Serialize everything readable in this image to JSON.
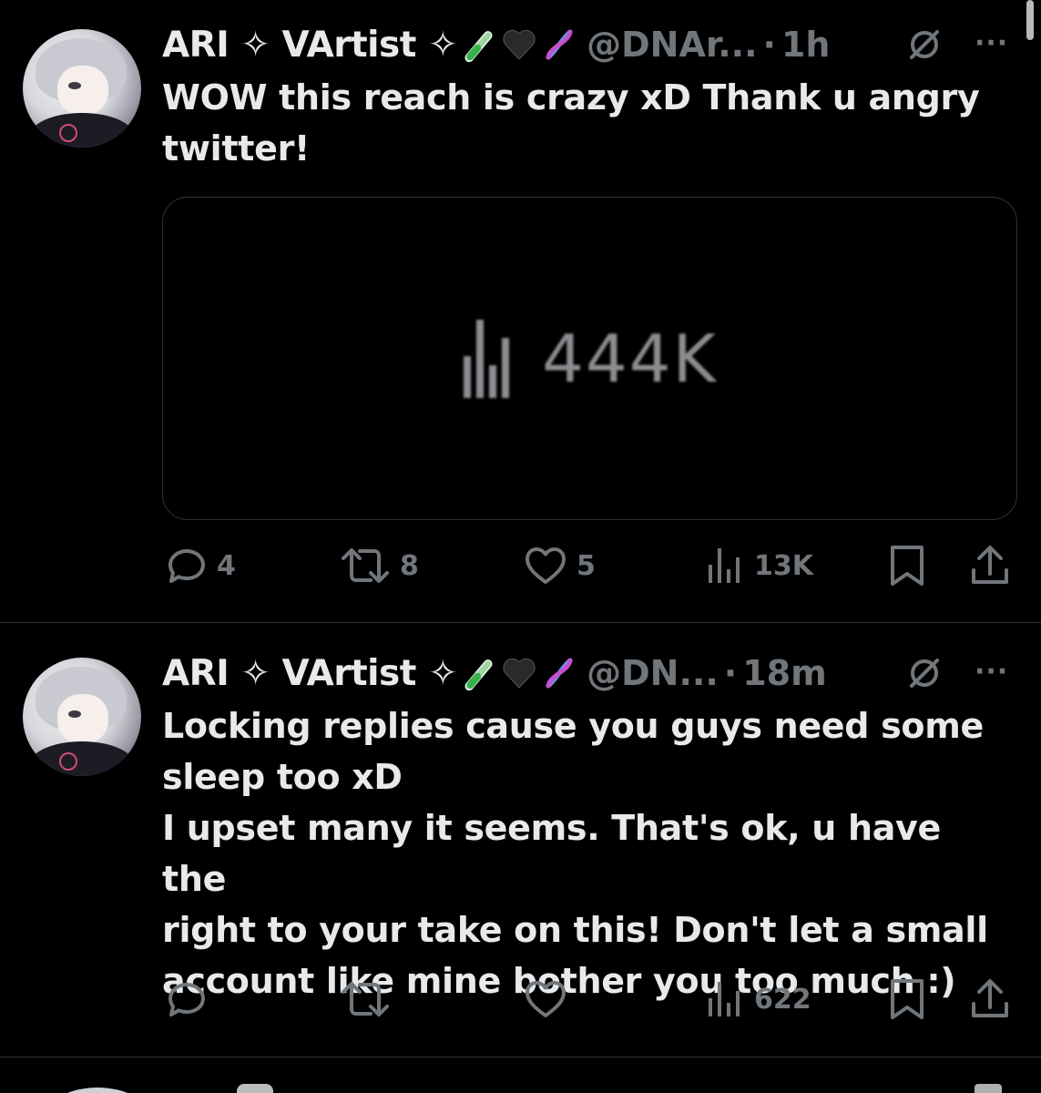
{
  "tweets": [
    {
      "display_name": "ARI ✧ VArtist ✧",
      "handle": "@DNAr...",
      "separator": "·",
      "time": "1h",
      "more": "···",
      "text_lines": [
        "WOW this reach is crazy xD Thank u angry",
        "twitter!"
      ],
      "media": {
        "views_label": "444K"
      },
      "actions": {
        "replies": "4",
        "reposts": "8",
        "likes": "5",
        "views": "13K"
      }
    },
    {
      "display_name": "ARI ✧ VArtist ✧",
      "handle": "@DN...",
      "separator": "·",
      "time": "18m",
      "more": "···",
      "text_lines": [
        "Locking replies cause you guys need some",
        "sleep too xD",
        "I upset many it seems. That's ok, u have the",
        "right to your take on this! Don't let a small",
        "account like mine bother you too much :)"
      ],
      "actions": {
        "replies": "",
        "reposts": "",
        "likes": "",
        "views": "622"
      }
    }
  ],
  "colors": {
    "background": "#000000",
    "text": "#e7e9ea",
    "muted": "#71767b",
    "border": "#2f3336"
  },
  "icons": [
    "test-tube-emoji",
    "black-heart-emoji",
    "dna-emoji",
    "grok-icon",
    "reply-icon",
    "repost-icon",
    "like-icon",
    "views-icon",
    "bookmark-icon",
    "share-icon"
  ]
}
